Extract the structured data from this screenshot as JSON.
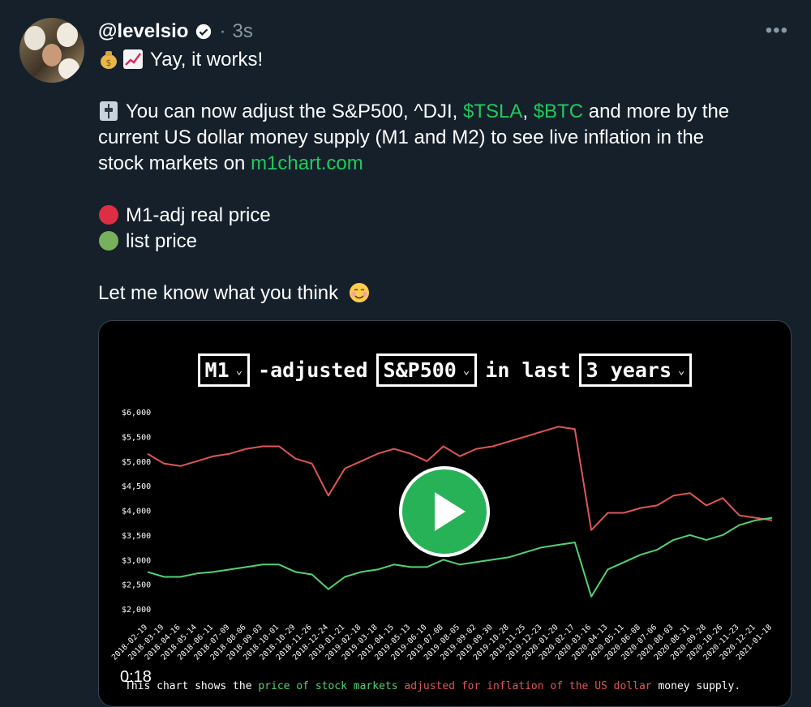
{
  "tweet": {
    "handle": "@levelsio",
    "dot": "·",
    "time": "3s",
    "more_label": "•••",
    "line1_text": "Yay, it works!",
    "line2": {
      "pre": "You can now adjust the S&P500, ^DJI, ",
      "tag1": "$TSLA",
      "sep": ", ",
      "tag2": "$BTC",
      "post": " and more by the"
    },
    "line3": "current US dollar money supply (M1 and M2) to see live inflation in the",
    "line4": {
      "pre": "stock markets on ",
      "link": "m1chart.com"
    },
    "legend_red": "M1-adj real price",
    "legend_green": "list price",
    "closing": "Let me know what you think",
    "icons": [
      "money-bag-icon",
      "chart-increasing-icon",
      "control-knobs-icon",
      "red-circle-icon",
      "green-circle-icon",
      "smiling-face-icon",
      "verified-badge-icon"
    ]
  },
  "video": {
    "title": {
      "select1": "M1",
      "middle": "-adjusted",
      "select2": "S&P500",
      "in_last": "in last",
      "select3": "3 years"
    },
    "duration": "0:18",
    "caption": {
      "pre": "This chart shows the ",
      "green": "price of stock markets",
      "mid": " ",
      "red": "adjusted for inflation of the US dollar",
      "post": " money supply."
    }
  },
  "chart_data": {
    "type": "line",
    "x": [
      "2018-02-19",
      "2018-03-19",
      "2018-04-16",
      "2018-05-14",
      "2018-06-11",
      "2018-07-09",
      "2018-08-06",
      "2018-09-03",
      "2018-10-01",
      "2018-10-29",
      "2018-11-26",
      "2018-12-24",
      "2019-01-21",
      "2019-02-18",
      "2019-03-18",
      "2019-04-15",
      "2019-05-13",
      "2019-06-10",
      "2019-07-08",
      "2019-08-05",
      "2019-09-02",
      "2019-09-30",
      "2019-10-28",
      "2019-11-25",
      "2019-12-23",
      "2020-01-20",
      "2020-02-17",
      "2020-03-16",
      "2020-04-13",
      "2020-05-11",
      "2020-06-08",
      "2020-07-06",
      "2020-08-03",
      "2020-08-31",
      "2020-09-28",
      "2020-10-26",
      "2020-11-23",
      "2020-12-21",
      "2021-01-18"
    ],
    "series": [
      {
        "color": "#e05656",
        "values": [
          5150,
          4950,
          4900,
          5000,
          5100,
          5150,
          5250,
          5300,
          5300,
          5050,
          4950,
          4300,
          4850,
          5000,
          5150,
          5250,
          5150,
          5000,
          5300,
          5100,
          5250,
          5300,
          5400,
          5500,
          5600,
          5700,
          5650,
          3600,
          3950,
          3950,
          4050,
          4100,
          4300,
          4350,
          4100,
          4250,
          3900,
          3850,
          3800
        ]
      },
      {
        "color": "#52d273",
        "values": [
          2750,
          2650,
          2650,
          2720,
          2750,
          2800,
          2850,
          2900,
          2900,
          2750,
          2700,
          2400,
          2650,
          2750,
          2800,
          2900,
          2850,
          2850,
          3000,
          2900,
          2950,
          3000,
          3050,
          3150,
          3250,
          3300,
          3350,
          2250,
          2800,
          2950,
          3100,
          3200,
          3400,
          3500,
          3400,
          3500,
          3700,
          3800,
          3850
        ]
      }
    ],
    "y_ticks": [
      "$6,000",
      "$5,500",
      "$5,000",
      "$4,500",
      "$4,000",
      "$3,500",
      "$3,000",
      "$2,500",
      "$2,000"
    ],
    "ylim": [
      2000,
      6000
    ],
    "grid": false
  }
}
